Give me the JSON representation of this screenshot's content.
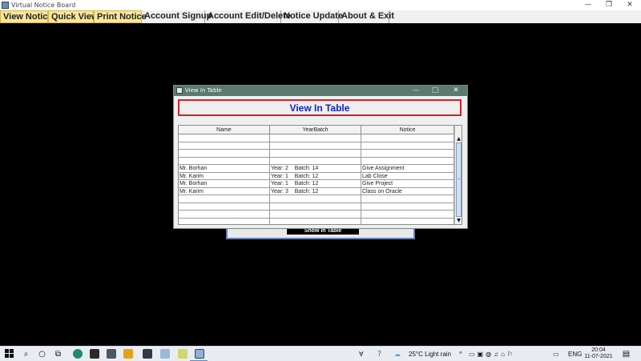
{
  "window": {
    "title": "Virtual Notice Board",
    "controls": [
      "—",
      "❐",
      "✕"
    ]
  },
  "menu": {
    "items": [
      {
        "label": "View Notice",
        "selected": true
      },
      {
        "label": "Quick View",
        "selected": true
      },
      {
        "label": "Print Notice",
        "selected": true
      },
      {
        "label": "Account Signup",
        "selected": false
      },
      {
        "label": "Account Edit/Delete",
        "selected": false
      },
      {
        "label": "Notice Update",
        "selected": false
      },
      {
        "label": "About & Exit",
        "selected": false
      }
    ]
  },
  "background": {
    "button_label": "Show In Table"
  },
  "dialog": {
    "title": "View In Table",
    "controls": [
      "—",
      "□",
      "✕"
    ],
    "header": "View In Table",
    "header_color": "#1122cc",
    "border_color": "#cc2222",
    "table": {
      "columns": [
        "Name",
        "YearBatch",
        "Notice"
      ],
      "rows": [
        [
          "",
          "",
          ""
        ],
        [
          "",
          "",
          ""
        ],
        [
          "",
          "",
          ""
        ],
        [
          "",
          "",
          ""
        ],
        [
          "Mr. Borhan",
          "Year: 2    Batch: 14",
          "Give Assignment"
        ],
        [
          "Mr. Karim",
          "Year: 1    Batch: 12",
          "Lab Close"
        ],
        [
          "Mr. Borhan",
          "Year: 1    Batch: 12",
          "Give Project"
        ],
        [
          "Mr. Karim",
          "Year: 3    Batch: 12",
          "Class on Oracle"
        ],
        [
          "",
          "",
          ""
        ],
        [
          "",
          "",
          ""
        ],
        [
          "",
          "",
          ""
        ],
        [
          "",
          "",
          ""
        ]
      ]
    }
  },
  "taskbar": {
    "weather": "25°C  Light rain",
    "language": "ENG",
    "time": "20:04",
    "date": "11-07-2021",
    "search_icon": "search-icon",
    "start_icon": "windows-start-icon"
  }
}
